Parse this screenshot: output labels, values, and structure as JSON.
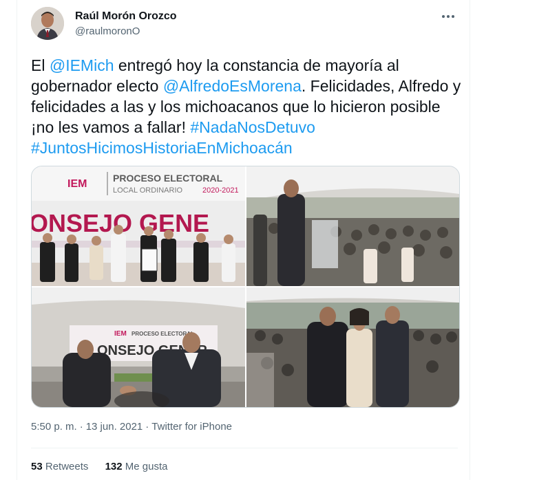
{
  "author": {
    "display_name": "Raúl Morón Orozco",
    "handle": "@raulmoronO"
  },
  "tweet": {
    "segments": [
      {
        "type": "text",
        "value": "El "
      },
      {
        "type": "mention",
        "value": "@IEMich"
      },
      {
        "type": "text",
        "value": " entregó hoy la constancia de mayoría al gobernador electo "
      },
      {
        "type": "mention",
        "value": "@AlfredoEsMorena"
      },
      {
        "type": "text",
        "value": ". Felicidades, Alfredo y felicidades a las y los michoacanos que lo hicieron posible ¡no les vamos a fallar! "
      },
      {
        "type": "hashtag",
        "value": "#NadaNosDetuvo"
      },
      {
        "type": "text",
        "value": " "
      },
      {
        "type": "hashtag",
        "value": "#JuntosHicimosHistoriaEnMichoacán"
      }
    ]
  },
  "photos": {
    "p1": {
      "logo": "IEM",
      "title": "PROCESO ELECTORAL",
      "subtitle": "LOCAL ORDINARIO",
      "year": "2020-2021",
      "banner": "ONSEJO GENE"
    },
    "p3": {
      "logo": "IEM",
      "title": "PROCESO ELECTORAL",
      "banner": "ONSEJO GENER"
    }
  },
  "meta": {
    "time": "5:50 p. m.",
    "separator": "·",
    "date": "13 jun. 2021",
    "source": "Twitter for iPhone"
  },
  "stats": {
    "retweets_count": "53",
    "retweets_label": "Retweets",
    "likes_count": "132",
    "likes_label": "Me gusta"
  },
  "icons": {
    "more": "more-dots-icon"
  },
  "colors": {
    "link": "#1d9bf0",
    "secondary_text": "#536471",
    "border": "#cfd9de"
  }
}
